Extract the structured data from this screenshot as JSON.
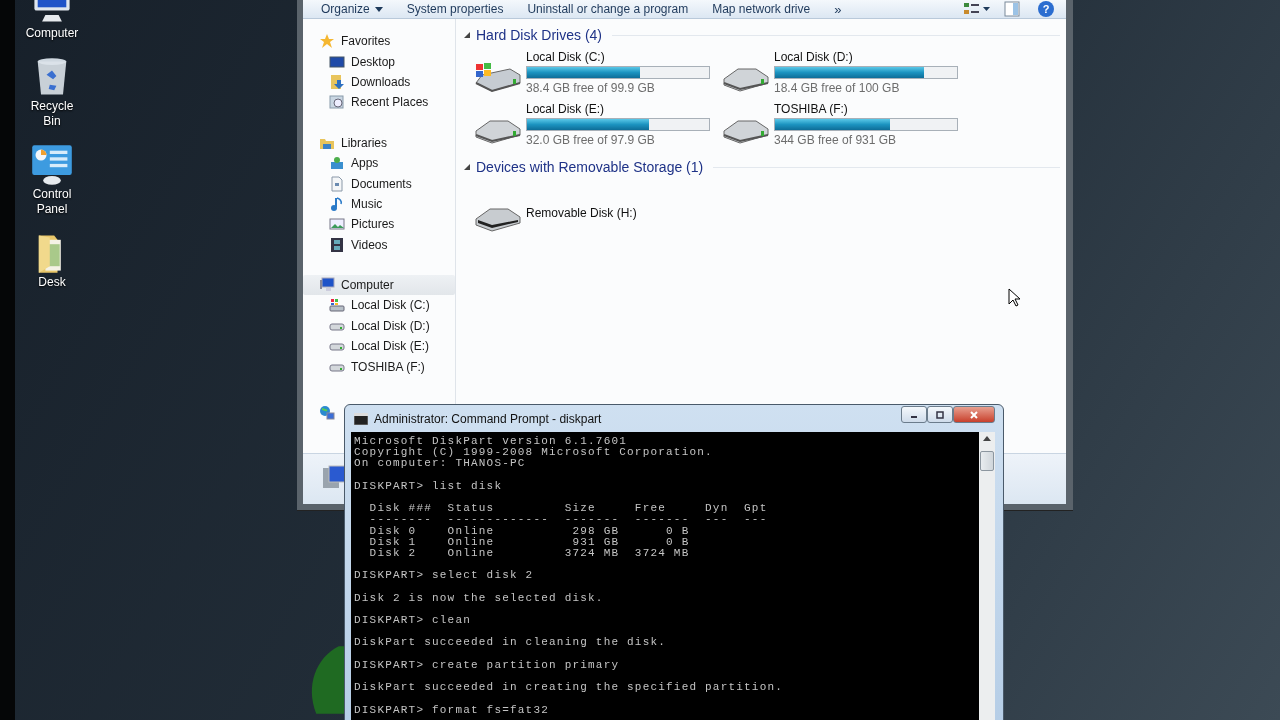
{
  "desktop_icons": [
    {
      "label": "Computer",
      "kind": "computer"
    },
    {
      "label": "Recycle Bin",
      "kind": "recycle"
    },
    {
      "label": "Control Panel",
      "kind": "control"
    },
    {
      "label": "Desk",
      "kind": "folder"
    }
  ],
  "explorer": {
    "toolbar": {
      "items": [
        {
          "label": "Organize",
          "dropdown": true
        },
        {
          "label": "System properties",
          "dropdown": false
        },
        {
          "label": "Uninstall or change a program",
          "dropdown": false
        },
        {
          "label": "Map network drive",
          "dropdown": false
        }
      ],
      "overflow": "»",
      "help": "?"
    },
    "nav": [
      {
        "label": "Favorites",
        "kind": "star",
        "selected": false,
        "children": [
          {
            "label": "Desktop",
            "kind": "desktop",
            "selected": false
          },
          {
            "label": "Downloads",
            "kind": "downloads",
            "selected": false
          },
          {
            "label": "Recent Places",
            "kind": "recent",
            "selected": false
          }
        ]
      },
      {
        "label": "Libraries",
        "kind": "library",
        "selected": false,
        "children": [
          {
            "label": "Apps",
            "kind": "apps",
            "selected": false
          },
          {
            "label": "Documents",
            "kind": "document",
            "selected": false
          },
          {
            "label": "Music",
            "kind": "music",
            "selected": false
          },
          {
            "label": "Pictures",
            "kind": "picture",
            "selected": false
          },
          {
            "label": "Videos",
            "kind": "video",
            "selected": false
          }
        ]
      },
      {
        "label": "Computer",
        "kind": "computer",
        "selected": true,
        "children": [
          {
            "label": "Local Disk (C:)",
            "kind": "system",
            "selected": false
          },
          {
            "label": "Local Disk (D:)",
            "kind": "drive",
            "selected": false
          },
          {
            "label": "Local Disk (E:)",
            "kind": "drive",
            "selected": false
          },
          {
            "label": "TOSHIBA (F:)",
            "kind": "drive",
            "selected": false
          }
        ]
      }
    ],
    "groups": [
      {
        "title": "Hard Disk Drives (4)",
        "drives": [
          {
            "name": "Local Disk (C:)",
            "kind": "system",
            "level": 0.62,
            "free": "38.4 GB free of 99.9 GB"
          },
          {
            "name": "Local Disk (D:)",
            "kind": "hdd",
            "level": 0.82,
            "free": "18.4 GB free of 100 GB"
          },
          {
            "name": "Local Disk (E:)",
            "kind": "hdd",
            "level": 0.67,
            "free": "32.0 GB free of 97.9 GB"
          },
          {
            "name": "TOSHIBA (F:)",
            "kind": "hdd",
            "level": 0.63,
            "free": "344 GB free of 931 GB"
          }
        ]
      },
      {
        "title": "Devices with Removable Storage (1)",
        "drives": [
          {
            "name": "Removable Disk (H:)",
            "kind": "removable"
          }
        ]
      }
    ]
  },
  "cmd": {
    "title": "Administrator: Command Prompt - diskpart",
    "blocks": [
      [
        "Microsoft DiskPart version 6.1.7601",
        "Copyright (C) 1999-2008 Microsoft Corporation.",
        "On computer: THANOS-PC"
      ],
      [
        "DISKPART> list disk"
      ],
      [
        "  Disk ###  Status         Size     Free     Dyn  Gpt",
        "  --------  -------------  -------  -------  ---  ---",
        "  Disk 0    Online          298 GB      0 B",
        "  Disk 1    Online          931 GB      0 B",
        "  Disk 2    Online         3724 MB  3724 MB"
      ],
      [
        "DISKPART> select disk 2"
      ],
      [
        "Disk 2 is now the selected disk."
      ],
      [
        "DISKPART> clean"
      ],
      [
        "DiskPart succeeded in cleaning the disk."
      ],
      [
        "DISKPART> create partition primary"
      ],
      [
        "DiskPart succeeded in creating the specified partition."
      ],
      [
        "DISKPART> format fs=fat32"
      ]
    ]
  }
}
